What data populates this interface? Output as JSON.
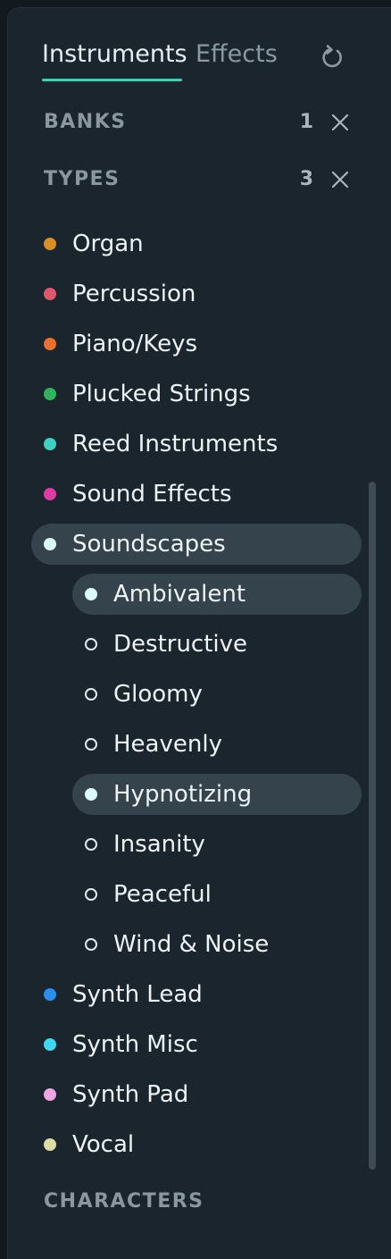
{
  "tabs": {
    "instruments": "Instruments",
    "effects": "Effects",
    "active": "Instruments"
  },
  "reset_icon": "reset-icon",
  "sections": {
    "banks": {
      "title": "BANKS",
      "count": "1"
    },
    "types": {
      "title": "TYPES",
      "count": "3"
    },
    "characters": {
      "title": "CHARACTERS"
    }
  },
  "types": [
    {
      "label": "Organ",
      "color": "#d98e27",
      "selected": false
    },
    {
      "label": "Percussion",
      "color": "#e0576a",
      "selected": false
    },
    {
      "label": "Piano/Keys",
      "color": "#ec6f32",
      "selected": false
    },
    {
      "label": "Plucked Strings",
      "color": "#2fb45a",
      "selected": false
    },
    {
      "label": "Reed Instruments",
      "color": "#3ed1c1",
      "selected": false
    },
    {
      "label": "Sound Effects",
      "color": "#e23aa4",
      "selected": false
    },
    {
      "label": "Soundscapes",
      "color": "#d9fbfb",
      "selected": true
    },
    {
      "label": "Synth Lead",
      "color": "#2a8ef0",
      "selected": false
    },
    {
      "label": "Synth Misc",
      "color": "#3fd6f3",
      "selected": false
    },
    {
      "label": "Synth Pad",
      "color": "#f1a5e6",
      "selected": false
    },
    {
      "label": "Vocal",
      "color": "#dcdca3",
      "selected": false
    }
  ],
  "subtypes": [
    {
      "label": "Ambivalent",
      "selected": true
    },
    {
      "label": "Destructive",
      "selected": false
    },
    {
      "label": "Gloomy",
      "selected": false
    },
    {
      "label": "Heavenly",
      "selected": false
    },
    {
      "label": "Hypnotizing",
      "selected": true
    },
    {
      "label": "Insanity",
      "selected": false
    },
    {
      "label": "Peaceful",
      "selected": false
    },
    {
      "label": "Wind & Noise",
      "selected": false
    }
  ],
  "colors": {
    "accent": "#4cc9b5",
    "selected_bg": "#34434c",
    "panel_bg": "#1a252d"
  }
}
